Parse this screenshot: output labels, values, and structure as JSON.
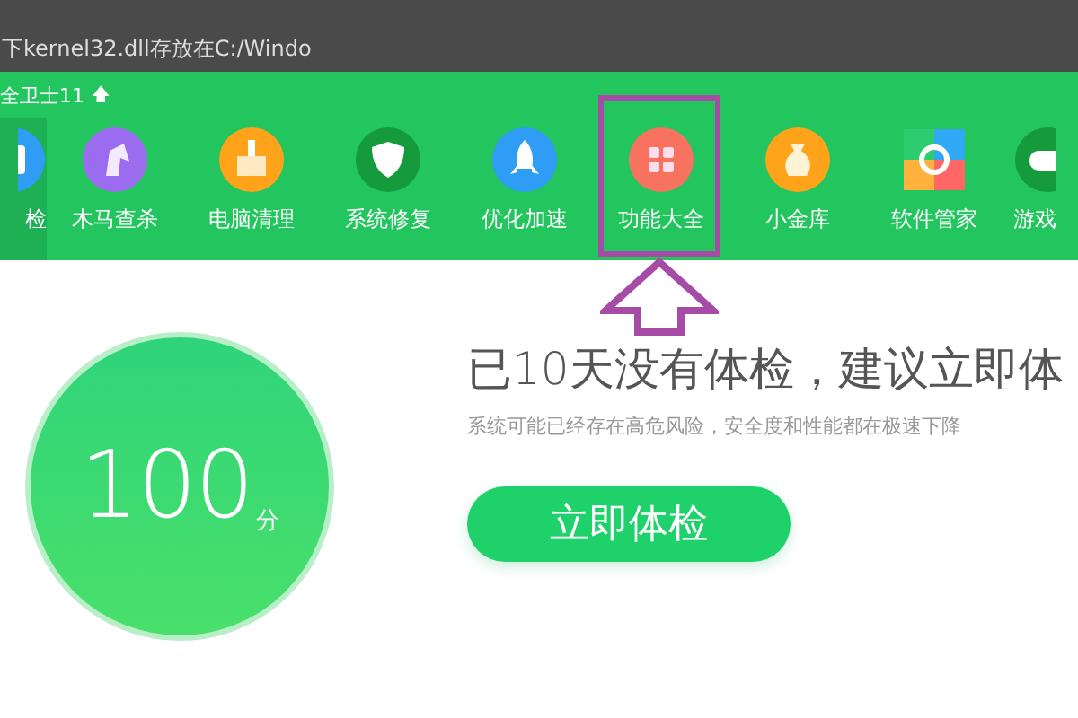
{
  "background_window": {
    "path_text": "下kernel32.dll存放在C:/Windo"
  },
  "app": {
    "title": "全卫士11",
    "update_mark": "🡅"
  },
  "nav": [
    {
      "label": "检",
      "selected": true
    },
    {
      "label": "木马查杀",
      "selected": false
    },
    {
      "label": "电脑清理",
      "selected": false
    },
    {
      "label": "系统修复",
      "selected": false
    },
    {
      "label": "优化加速",
      "selected": false
    },
    {
      "label": "功能大全",
      "selected": false
    },
    {
      "label": "小金库",
      "selected": false
    },
    {
      "label": "软件管家",
      "selected": false
    },
    {
      "label": "游戏",
      "selected": false
    }
  ],
  "score": {
    "value": "100",
    "unit": "分"
  },
  "message": {
    "title": "已10天没有体检，建议立即体",
    "subtitle": "系统可能已经存在高危风险，安全度和性能都在极速下降"
  },
  "action_button": "立即体检"
}
